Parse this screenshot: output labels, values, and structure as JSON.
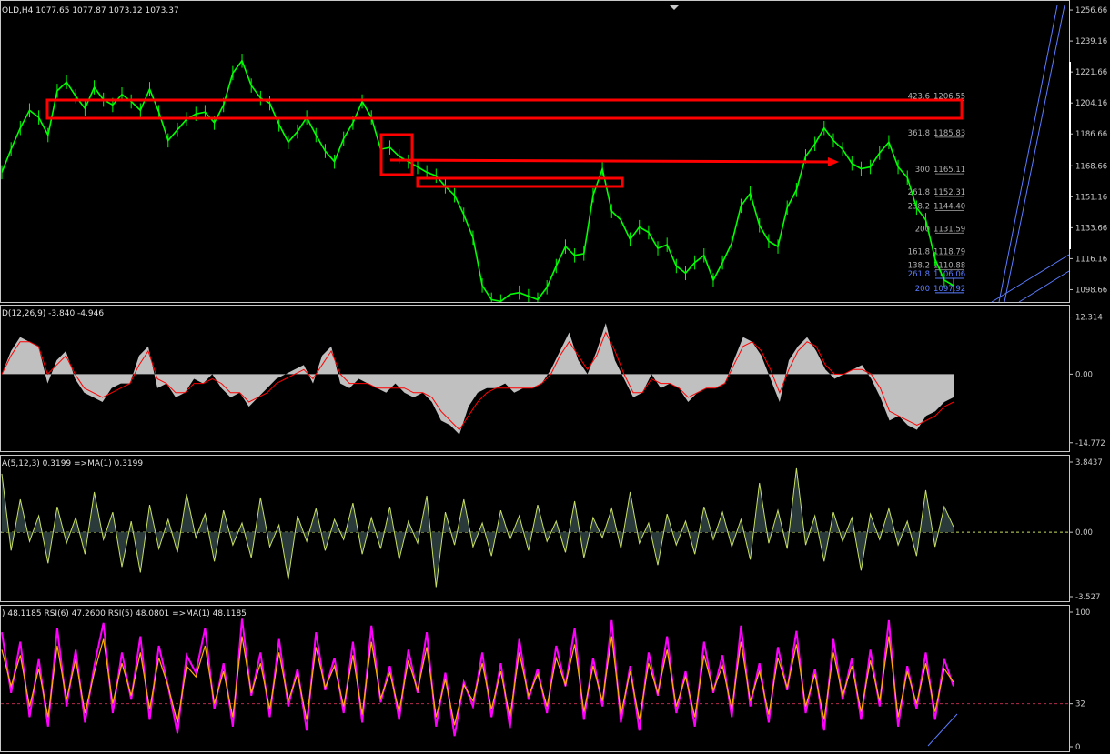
{
  "colors": {
    "background": "#000000",
    "axis": "#c8c8c8",
    "price": "#00ff00",
    "box": "#ff0000",
    "macd_hist": "#c0c0c0",
    "macd_signal": "#ff0000",
    "osma": "#c8e060",
    "osma_fill": "#2a3a3a",
    "rsi_fast": "#ff00ff",
    "rsi_slow": "#ffb000",
    "rsi_level": "#b22b4b",
    "fib": "#b0b0b0",
    "fib_blue": "#5a7cff"
  },
  "panes": {
    "main": {
      "label": "OLD,H4  1077.65 1077.87 1073.12 1073.37"
    },
    "macd": {
      "label": "D(12,26,9) -3.840 -4.946"
    },
    "osma": {
      "label": "A(5,12,3) 0.3199  =>MA(1) 0.3199"
    },
    "rsi": {
      "label": ") 48.1185  RSI(6) 47.2600  RSI(5) 48.0801  =>MA(1) 48.1185"
    }
  },
  "chart_data": [
    {
      "type": "line",
      "pane": "price",
      "series": [
        {
          "values": [
            1165,
            1178,
            1190,
            1200,
            1196,
            1186,
            1211,
            1216,
            1208,
            1201,
            1213,
            1206,
            1203,
            1209,
            1205,
            1200,
            1212,
            1199,
            1183,
            1189,
            1195,
            1198,
            1199,
            1193,
            1203,
            1221,
            1228,
            1214,
            1207,
            1204,
            1192,
            1182,
            1188,
            1196,
            1186,
            1177,
            1171,
            1184,
            1193,
            1205,
            1196,
            1178,
            1179,
            1174,
            1171,
            1168,
            1165,
            1163,
            1157,
            1152,
            1141,
            1128,
            1101,
            1093,
            1092,
            1096,
            1097,
            1095,
            1093,
            1100,
            1112,
            1123,
            1118,
            1119,
            1152,
            1167,
            1143,
            1138,
            1127,
            1134,
            1131,
            1122,
            1124,
            1112,
            1108,
            1114,
            1118,
            1104,
            1114,
            1125,
            1146,
            1153,
            1135,
            1126,
            1123,
            1145,
            1155,
            1174,
            1181,
            1190,
            1183,
            1178,
            1170,
            1167,
            1168,
            1176,
            1182,
            1168,
            1162,
            1145,
            1138,
            1116,
            1104,
            1101
          ]
        }
      ],
      "ylim": [
        1092.2,
        1260.8
      ],
      "y_ticks": [
        "1256.66",
        "1239.16",
        "1221.66",
        "1204.16",
        "1186.66",
        "1168.66",
        "1151.16",
        "1133.66",
        "1116.16",
        "1098.66"
      ],
      "fib_levels": [
        {
          "ratio": "423.6",
          "price": "1206.55",
          "value": 1206.55
        },
        {
          "ratio": "361.8",
          "price": "1185.83",
          "value": 1185.83
        },
        {
          "ratio": "300",
          "price": "1165.11",
          "value": 1165.11
        },
        {
          "ratio": "261.8",
          "price": "1152.31",
          "value": 1152.31
        },
        {
          "ratio": "238.2",
          "price": "1144.40",
          "value": 1144.4
        },
        {
          "ratio": "200",
          "price": "1131.59",
          "value": 1131.59
        },
        {
          "ratio": "161.8",
          "price": "1118.79",
          "value": 1118.79
        },
        {
          "ratio": "138.2",
          "price": "1110.88",
          "value": 1110.88
        },
        {
          "ratio": "261.8",
          "price": "1106.06",
          "value": 1106.06
        },
        {
          "ratio": "200",
          "price": "1097.92",
          "value": 1097.92
        }
      ]
    },
    {
      "type": "area",
      "pane": "macd",
      "ylim": [
        -15.6,
        13.4
      ],
      "y_ticks": [
        "12.314",
        "0.00",
        "-14.772"
      ],
      "series": [
        {
          "values": [
            0,
            5,
            8,
            7,
            6,
            -2,
            3,
            5,
            -1,
            -4,
            -5,
            -6,
            -3,
            -2,
            -2,
            4,
            6,
            -3,
            -2,
            -5,
            -4,
            -1,
            -2,
            0,
            -3,
            -5,
            -4,
            -7,
            -5,
            -3,
            -1,
            0,
            1,
            2,
            -2,
            4,
            6,
            -2,
            -3,
            -1,
            -2,
            -3,
            -4,
            -2,
            -4,
            -5,
            -4,
            -6,
            -10,
            -11,
            -13,
            -7,
            -4,
            -3,
            -3,
            -2,
            -4,
            -3,
            -3,
            -2,
            1,
            5,
            9,
            3,
            0,
            5,
            11,
            3,
            -1,
            -5,
            -4,
            0,
            -3,
            -2,
            -3,
            -6,
            -4,
            -3,
            -3,
            -2,
            3,
            8,
            7,
            4,
            -1,
            -6,
            3,
            6,
            8,
            5,
            1,
            -1,
            0,
            1,
            2,
            -1,
            -5,
            -10,
            -9,
            -11,
            -12,
            -9,
            -8,
            -6,
            -5
          ]
        },
        {
          "values": [
            0,
            4,
            7,
            7,
            6,
            0,
            2,
            4,
            0,
            -3,
            -4,
            -5,
            -4,
            -3,
            -2,
            2,
            5,
            -1,
            -2,
            -4,
            -4,
            -2,
            -2,
            -1,
            -2,
            -4,
            -4,
            -6,
            -5,
            -4,
            -2,
            -1,
            0,
            1,
            -1,
            2,
            5,
            0,
            -2,
            -2,
            -2,
            -3,
            -3,
            -3,
            -3,
            -4,
            -4,
            -5,
            -8,
            -10,
            -12,
            -9,
            -6,
            -4,
            -3,
            -3,
            -3,
            -3,
            -3,
            -2,
            0,
            4,
            7,
            4,
            1,
            4,
            9,
            5,
            0,
            -4,
            -4,
            -1,
            -2,
            -2,
            -3,
            -5,
            -4,
            -3,
            -3,
            -2,
            2,
            6,
            7,
            5,
            1,
            -4,
            1,
            5,
            7,
            6,
            2,
            0,
            0,
            1,
            1,
            0,
            -3,
            -8,
            -9,
            -10,
            -11,
            -10,
            -9,
            -7,
            -6
          ]
        }
      ]
    },
    {
      "type": "bar",
      "pane": "osma",
      "ylim": [
        -3.527,
        3.8437
      ],
      "y_ticks": [
        "3.8437",
        "0.00",
        "-3.527"
      ],
      "values": [
        3.2,
        -1.0,
        1.8,
        -0.5,
        0.9,
        -1.7,
        1.4,
        -0.6,
        0.8,
        -1.2,
        2.2,
        -0.4,
        1.1,
        -1.9,
        0.6,
        -2.2,
        1.5,
        -0.9,
        0.7,
        -1.1,
        2.1,
        -0.3,
        1.0,
        -1.6,
        1.2,
        -0.7,
        0.5,
        -1.4,
        1.9,
        -0.8,
        0.4,
        -2.6,
        0.9,
        -0.5,
        1.3,
        -1.0,
        0.7,
        -0.4,
        1.6,
        -1.2,
        0.8,
        -0.9,
        1.4,
        -1.5,
        0.6,
        -0.6,
        2.0,
        -3.0,
        1.1,
        -0.7,
        1.8,
        -0.8,
        0.5,
        -1.3,
        1.2,
        -0.4,
        0.9,
        -1.0,
        1.5,
        -0.5,
        0.6,
        -1.1,
        1.7,
        -1.4,
        0.8,
        -0.3,
        1.3,
        -0.9,
        2.2,
        -0.6,
        0.5,
        -1.8,
        1.0,
        -0.7,
        0.6,
        -1.2,
        1.4,
        -0.4,
        1.1,
        -0.8,
        0.7,
        -1.5,
        2.7,
        -0.6,
        1.2,
        -0.9,
        3.5,
        -0.7,
        0.9,
        -1.6,
        1.1,
        -0.5,
        0.8,
        -2.1,
        1.0,
        -0.4,
        1.3,
        -0.7,
        0.6,
        -1.3,
        2.3,
        -0.8,
        1.4,
        0.3
      ]
    },
    {
      "type": "line",
      "pane": "rsi",
      "ylim": [
        0,
        100
      ],
      "y_ticks": [
        "100",
        "32",
        "0"
      ],
      "level": 32,
      "series": [
        {
          "values": [
            85,
            40,
            78,
            22,
            65,
            15,
            88,
            30,
            72,
            18,
            60,
            92,
            25,
            70,
            35,
            82,
            20,
            75,
            45,
            10,
            68,
            55,
            88,
            28,
            62,
            15,
            95,
            38,
            70,
            22,
            80,
            30,
            58,
            12,
            85,
            42,
            66,
            25,
            78,
            18,
            90,
            33,
            60,
            20,
            72,
            40,
            85,
            15,
            55,
            8,
            48,
            30,
            70,
            22,
            62,
            14,
            80,
            35,
            58,
            25,
            75,
            45,
            88,
            20,
            66,
            30,
            94,
            18,
            60,
            12,
            70,
            38,
            82,
            25,
            56,
            15,
            78,
            40,
            68,
            22,
            90,
            30,
            62,
            18,
            74,
            42,
            86,
            25,
            58,
            12,
            80,
            35,
            66,
            20,
            72,
            30,
            94,
            15,
            60,
            28,
            70,
            20,
            65,
            45
          ]
        },
        {
          "values": [
            72,
            45,
            68,
            30,
            58,
            22,
            75,
            35,
            65,
            25,
            55,
            80,
            32,
            62,
            38,
            70,
            28,
            66,
            45,
            18,
            60,
            52,
            75,
            32,
            56,
            22,
            82,
            40,
            62,
            28,
            70,
            34,
            54,
            20,
            74,
            44,
            60,
            30,
            68,
            24,
            78,
            36,
            55,
            26,
            64,
            42,
            74,
            22,
            50,
            16,
            46,
            34,
            62,
            28,
            56,
            22,
            70,
            38,
            54,
            30,
            66,
            46,
            76,
            26,
            60,
            34,
            82,
            24,
            56,
            20,
            62,
            40,
            72,
            30,
            52,
            22,
            68,
            42,
            60,
            28,
            78,
            34,
            56,
            24,
            66,
            44,
            76,
            30,
            54,
            20,
            70,
            38,
            60,
            26,
            64,
            34,
            82,
            22,
            56,
            32,
            62,
            26,
            58,
            48
          ]
        }
      ]
    }
  ]
}
